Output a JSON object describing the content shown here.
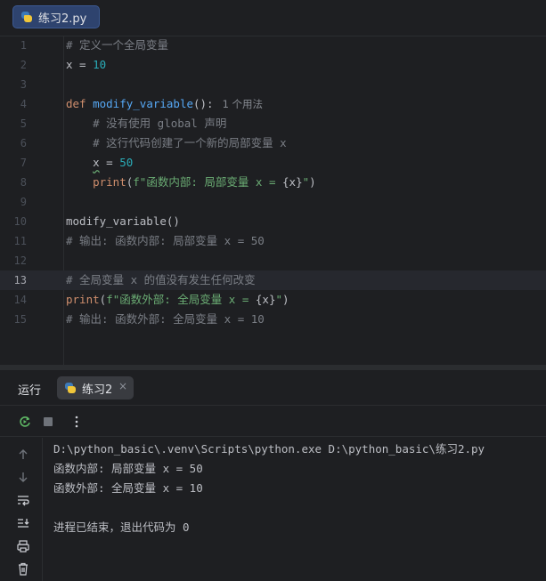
{
  "editor": {
    "tab_label": "练习2.py",
    "lines": [
      {
        "n": "1",
        "parts": [
          [
            "cm",
            "# 定义一个全局变量"
          ]
        ]
      },
      {
        "n": "2",
        "parts": [
          [
            "plain",
            "x = "
          ],
          [
            "num",
            "10"
          ]
        ]
      },
      {
        "n": "3",
        "parts": []
      },
      {
        "n": "4",
        "parts": [
          [
            "kw",
            "def "
          ],
          [
            "fn",
            "modify_variable"
          ],
          [
            "plain",
            "():"
          ],
          [
            "hint",
            "1 个用法"
          ]
        ]
      },
      {
        "n": "5",
        "parts": [
          [
            "cm",
            "    # 没有使用 global 声明"
          ]
        ]
      },
      {
        "n": "6",
        "parts": [
          [
            "cm",
            "    # 这行代码创建了一个新的局部变量 x"
          ]
        ]
      },
      {
        "n": "7",
        "parts": [
          [
            "plain",
            "    "
          ],
          [
            "sq",
            "x"
          ],
          [
            "plain",
            " = "
          ],
          [
            "num",
            "50"
          ]
        ]
      },
      {
        "n": "8",
        "parts": [
          [
            "plain",
            "    "
          ],
          [
            "kw2",
            "print"
          ],
          [
            "plain",
            "("
          ],
          [
            "str",
            "f\"函数内部: 局部变量 x = "
          ],
          [
            "plain",
            "{x}"
          ],
          [
            "str",
            "\""
          ],
          [
            "plain",
            ")"
          ]
        ]
      },
      {
        "n": "9",
        "parts": []
      },
      {
        "n": "10",
        "parts": [
          [
            "plain",
            "modify_variable()"
          ]
        ]
      },
      {
        "n": "11",
        "parts": [
          [
            "cm",
            "# 输出: 函数内部: 局部变量 x = 50"
          ]
        ]
      },
      {
        "n": "12",
        "parts": []
      },
      {
        "n": "13",
        "parts": [
          [
            "cm",
            "# 全局变量 x 的值没有发生任何改变"
          ]
        ],
        "highlight": true
      },
      {
        "n": "14",
        "parts": [
          [
            "kw2",
            "print"
          ],
          [
            "plain",
            "("
          ],
          [
            "str",
            "f\"函数外部: 全局变量 x = "
          ],
          [
            "plain",
            "{x}"
          ],
          [
            "str",
            "\""
          ],
          [
            "plain",
            ")"
          ]
        ]
      },
      {
        "n": "15",
        "parts": [
          [
            "cm",
            "# 输出: 函数外部: 全局变量 x = 10"
          ]
        ]
      }
    ]
  },
  "run": {
    "title": "运行",
    "tab_label": "练习2",
    "close": "×",
    "console": [
      "D:\\python_basic\\.venv\\Scripts\\python.exe D:\\python_basic\\练习2.py",
      "函数内部: 局部变量 x = 50",
      "函数外部: 全局变量 x = 10",
      "",
      "进程已结束，退出代码为 0"
    ]
  },
  "colors": {
    "comment": "#7a7e85",
    "keyword": "#cf8e6d",
    "function": "#56a8f5",
    "number": "#2aacb8",
    "string": "#6aab73",
    "accent_tab": "#2e436e"
  },
  "icons": [
    "python-file-icon",
    "rerun-icon",
    "stop-icon",
    "more-options-icon",
    "arrow-up-icon",
    "arrow-down-icon",
    "soft-wrap-icon",
    "scroll-to-end-icon",
    "print-icon",
    "trash-icon"
  ]
}
